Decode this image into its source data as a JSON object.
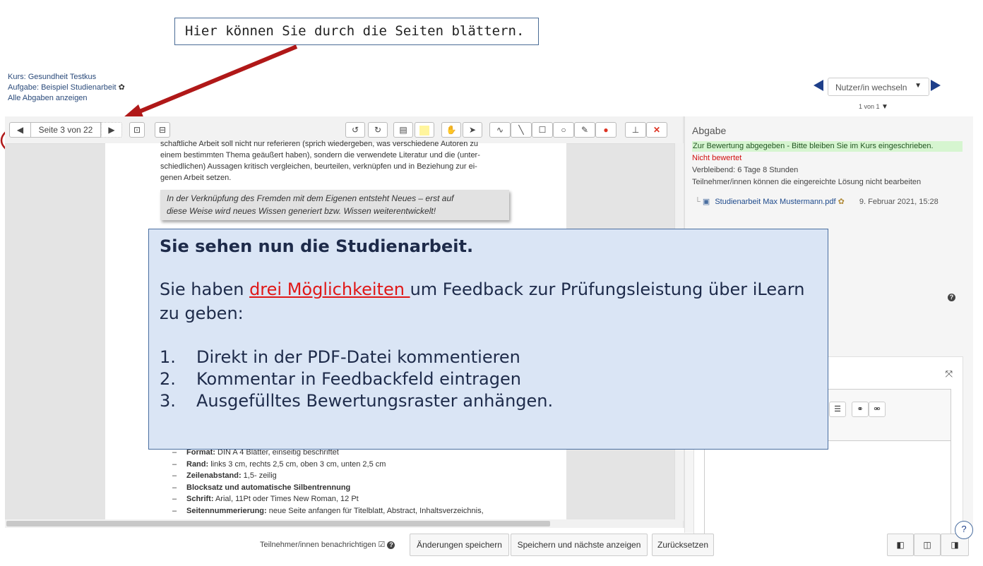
{
  "callout_top": "Hier können Sie durch die Seiten blättern.",
  "info": {
    "kurs": "Kurs: Gesundheit Testkus",
    "aufgabe": "Aufgabe: Beispiel Studienarbeit",
    "alle": "Alle Abgaben anzeigen"
  },
  "user_switch": {
    "label": "Nutzer/in wechseln",
    "count": "1 von 1"
  },
  "toolbar": {
    "page_label": "Seite 3 von 22"
  },
  "document": {
    "lines_top": [
      "schaftliche Arbeit soll nicht nur referieren (sprich wiedergeben, was verschiedene Autoren zu",
      "einem bestimmten Thema geäußert haben), sondern die verwendete Literatur und die (unter-",
      "schiedlichen) Aussagen kritisch vergleichen, beurteilen, verknüpfen und in Beziehung zur ei-",
      "genen Arbeit setzen."
    ],
    "quote_1": "In der Verknüpfung des Fremden mit dem Eigenen entsteht Neues – erst auf",
    "quote_2": "diese Weise wird neues Wissen generiert bzw. Wissen weiterentwickelt!",
    "list": [
      {
        "bold": "Format:",
        "text": " DIN A 4 Blätter, einseitig beschriftet"
      },
      {
        "bold": "Rand:",
        "text": " links 3 cm, rechts 2,5 cm, oben 3 cm, unten 2,5 cm"
      },
      {
        "bold": "Zeilenabstand:",
        "text": " 1,5- zeilig"
      },
      {
        "bold": "Blocksatz und automatische Silbentrennung",
        "text": ""
      },
      {
        "bold": "Schrift:",
        "text": " Arial, 11Pt oder Times New Roman, 12 Pt"
      },
      {
        "bold": "Seitennummerierung:",
        "text": " neue Seite anfangen für Titelblatt, Abstract, Inhaltsverzeichnis,"
      }
    ]
  },
  "panel": {
    "title": "Abgabe",
    "status_green": "Zur Bewertung abgegeben - Bitte bleiben Sie im Kurs eingeschrieben.",
    "status_red": "Nicht bewertet",
    "remaining": "Verbleibend: 6 Tage 8 Stunden",
    "no_edit": "Teilnehmer/innen können die eingereichte Lösung nicht bearbeiten",
    "file_name": "Studienarbeit Max Mustermann.pdf",
    "file_date": "9. Februar 2021, 15:28"
  },
  "overlay": {
    "title": "Sie sehen nun die Studienarbeit.",
    "intro_before": "Sie haben ",
    "intro_highlight": "drei Möglichkeiten ",
    "intro_after": "um Feedback zur Prüfungsleistung über iLearn zu geben:",
    "items": [
      {
        "num": "1.",
        "text": "Direkt in der PDF-Datei kommentieren"
      },
      {
        "num": "2.",
        "text": "Kommentar in Feedbackfeld eintragen"
      },
      {
        "num": "3.",
        "text": "Ausgefülltes Bewertungsraster anhängen."
      }
    ]
  },
  "footer": {
    "notify": "Teilnehmer/innen benachrichtigen ☑",
    "save": "Änderungen speichern",
    "save_next": "Speichern und nächste anzeigen",
    "reset": "Zurücksetzen"
  },
  "colors": {
    "annotation_red": "#b01818",
    "nav_blue": "#1e3f8a",
    "overlay_bg": "#dae5f5"
  }
}
